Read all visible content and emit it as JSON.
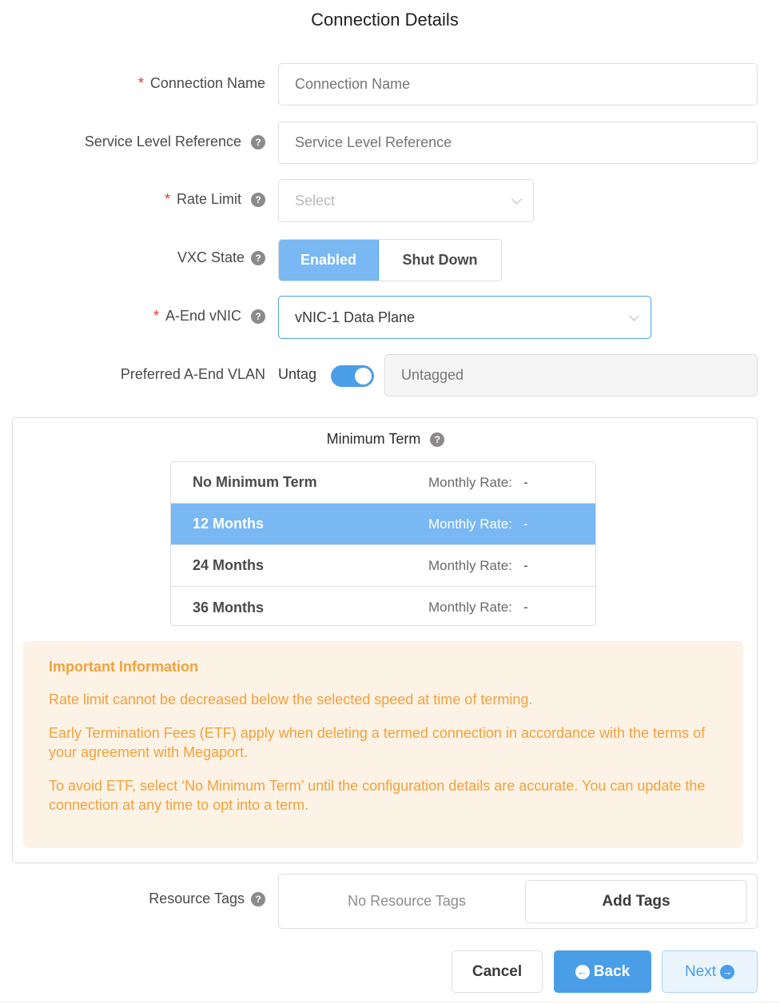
{
  "page": {
    "title": "Connection Details"
  },
  "fields": {
    "connection_name": {
      "label": "Connection Name",
      "required": true,
      "placeholder": "Connection Name",
      "value": ""
    },
    "service_level_reference": {
      "label": "Service Level Reference",
      "placeholder": "Service Level Reference",
      "value": ""
    },
    "rate_limit": {
      "label": "Rate Limit",
      "required": true,
      "placeholder": "Select",
      "value": ""
    },
    "vxc_state": {
      "label": "VXC State",
      "options": [
        "Enabled",
        "Shut Down"
      ],
      "selected": "Enabled"
    },
    "a_end_vnic": {
      "label": "A-End vNIC",
      "required": true,
      "value": "vNIC-1 Data Plane"
    },
    "preferred_vlan": {
      "label": "Preferred A-End VLAN",
      "untag_label": "Untag",
      "untag_on": true,
      "placeholder": "Untagged"
    }
  },
  "icons": {
    "help": "?",
    "required": "*",
    "back": "←",
    "next": "→"
  },
  "minimum_term": {
    "title": "Minimum Term",
    "items": [
      {
        "name": "No Minimum Term",
        "rate_label": "Monthly Rate:",
        "rate_value": "-",
        "selected": false
      },
      {
        "name": "12 Months",
        "rate_label": "Monthly Rate:",
        "rate_value": "-",
        "selected": true
      },
      {
        "name": "24 Months",
        "rate_label": "Monthly Rate:",
        "rate_value": "-",
        "selected": false
      },
      {
        "name": "36 Months",
        "rate_label": "Monthly Rate:",
        "rate_value": "-",
        "selected": false
      }
    ]
  },
  "info": {
    "title": "Important Information",
    "paragraphs": [
      "Rate limit cannot be decreased below the selected speed at time of terming.",
      "Early Termination Fees (ETF) apply when deleting a termed connection in accordance with the terms of your agreement with Megaport.",
      "To avoid ETF, select ‘No Minimum Term’ until the configuration details are accurate. You can update the connection at any time to opt into a term."
    ]
  },
  "resource_tags": {
    "label": "Resource Tags",
    "empty_text": "No Resource Tags",
    "add_label": "Add Tags"
  },
  "actions": {
    "cancel": "Cancel",
    "back": "Back",
    "next": "Next"
  },
  "colors": {
    "accent": "#4a9ee8",
    "selected": "#79b8f3",
    "warning_text": "#f0a23c",
    "warning_bg": "#fdf2e6",
    "required": "#e0352b"
  }
}
